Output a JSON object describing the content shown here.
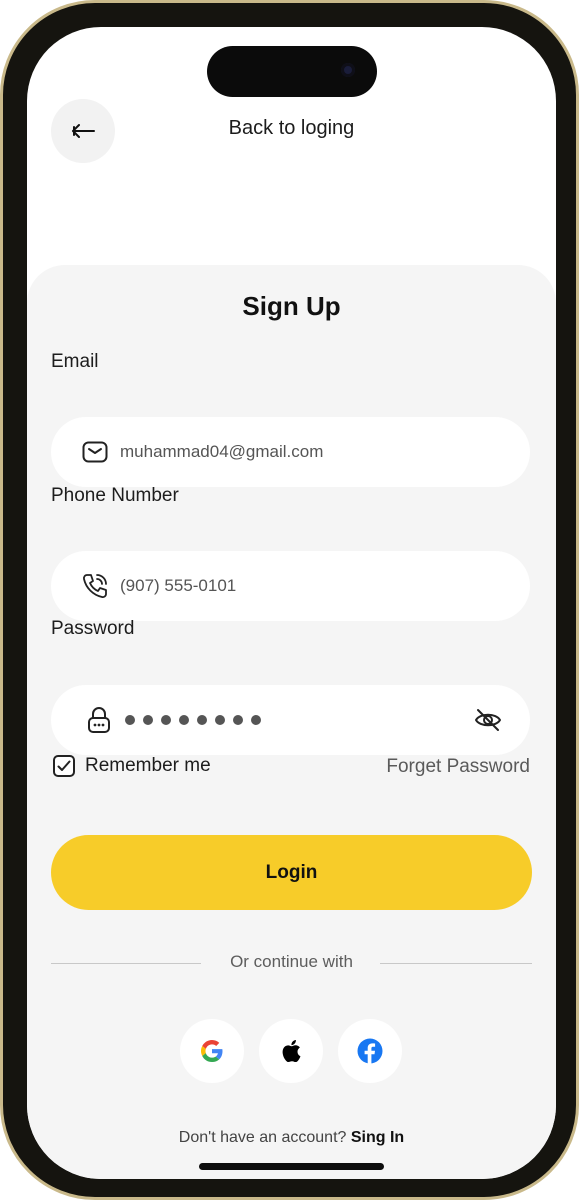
{
  "header": {
    "title": "Back to loging"
  },
  "form": {
    "title": "Sign Up",
    "email": {
      "label": "Email",
      "value": "muhammad04@gmail.com"
    },
    "phone": {
      "label": "Phone Number",
      "value": "(907) 555-0101"
    },
    "password": {
      "label": "Password",
      "masked_length": 8
    },
    "remember": {
      "label": "Remember me",
      "checked": true
    },
    "forget_label": "Forget Password",
    "submit_label": "Login",
    "divider_text": "Or continue with",
    "social": [
      "google-icon",
      "apple-icon",
      "facebook-icon"
    ],
    "footer": {
      "prompt": "Don't have an account? ",
      "link": "Sing In"
    }
  },
  "colors": {
    "accent": "#f7cc29",
    "card_bg": "#f5f5f5",
    "facebook": "#1877f2"
  }
}
